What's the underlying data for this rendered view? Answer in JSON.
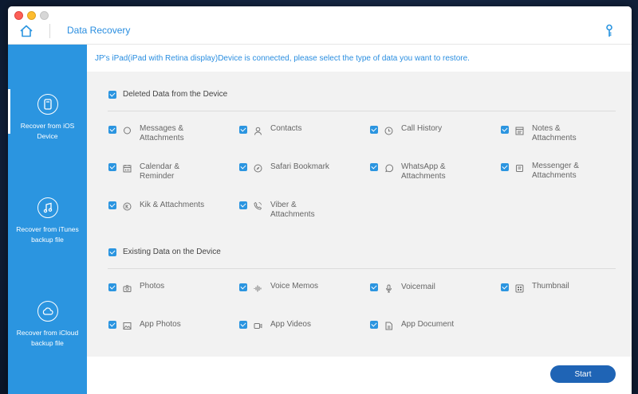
{
  "window": {
    "title": "Data Recovery"
  },
  "headline": "JP's iPad(iPad with Retina display)Device is connected, please select the type of data you want to restore.",
  "sidebar": {
    "items": [
      {
        "label": "Recover from iOS Device",
        "icon": "ios-device-icon",
        "active": true
      },
      {
        "label": "Recover from iTunes backup file",
        "icon": "music-note-icon",
        "active": false
      },
      {
        "label": "Recover from iCloud backup file",
        "icon": "cloud-icon",
        "active": false
      }
    ]
  },
  "sections": [
    {
      "title": "Deleted Data from the Device",
      "checked": true,
      "items": [
        {
          "label": "Messages & Attachments",
          "icon": "messages-icon",
          "checked": true
        },
        {
          "label": "Contacts",
          "icon": "contacts-icon",
          "checked": true
        },
        {
          "label": "Call History",
          "icon": "clock-icon",
          "checked": true
        },
        {
          "label": "Notes & Attachments",
          "icon": "notes-icon",
          "checked": true
        },
        {
          "label": "Calendar & Reminder",
          "icon": "calendar-icon",
          "checked": true
        },
        {
          "label": "Safari Bookmark",
          "icon": "compass-icon",
          "checked": true
        },
        {
          "label": "WhatsApp & Attachments",
          "icon": "whatsapp-icon",
          "checked": true
        },
        {
          "label": "Messenger & Attachments",
          "icon": "messenger-icon",
          "checked": true
        },
        {
          "label": "Kik & Attachments",
          "icon": "kik-icon",
          "checked": true
        },
        {
          "label": "Viber & Attachments",
          "icon": "viber-icon",
          "checked": true
        }
      ]
    },
    {
      "title": "Existing Data on the Device",
      "checked": true,
      "items": [
        {
          "label": "Photos",
          "icon": "camera-icon",
          "checked": true
        },
        {
          "label": "Voice Memos",
          "icon": "waveform-icon",
          "checked": true
        },
        {
          "label": "Voicemail",
          "icon": "microphone-icon",
          "checked": true
        },
        {
          "label": "Thumbnail",
          "icon": "thumbnail-icon",
          "checked": true
        },
        {
          "label": "App Photos",
          "icon": "image-icon",
          "checked": true
        },
        {
          "label": "App Videos",
          "icon": "video-icon",
          "checked": true
        },
        {
          "label": "App Document",
          "icon": "document-icon",
          "checked": true
        }
      ]
    }
  ],
  "footer": {
    "start_label": "Start"
  },
  "colors": {
    "accent": "#2b95e0",
    "sidebar": "#2b95e0",
    "start_button": "#1f64b5",
    "headline_text": "#2a8ee0"
  }
}
